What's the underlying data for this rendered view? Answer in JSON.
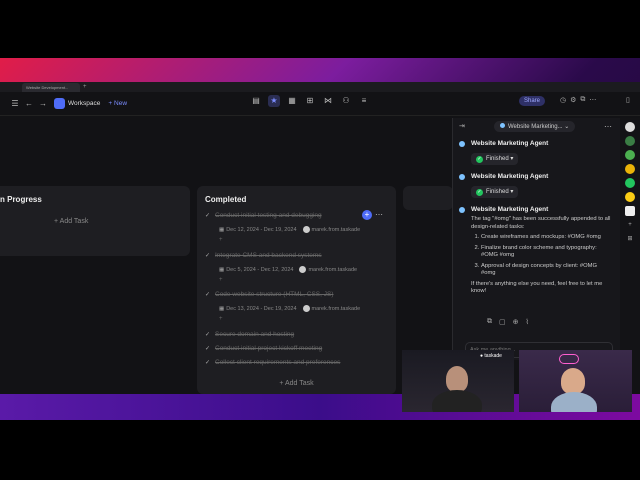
{
  "browser": {
    "tab_title": "Website Development...",
    "tab_new": "+"
  },
  "toolbar": {
    "workspace": "Workspace",
    "new": "+ New",
    "share": "Share",
    "icons": [
      "sidebar-toggle-icon",
      "back-icon",
      "forward-icon",
      "document-icon",
      "star-icon",
      "calendar-icon",
      "table-icon",
      "graph-icon",
      "org-chart-icon",
      "list-icon",
      "history-icon",
      "settings-icon",
      "copy-icon",
      "more-icon",
      "panel-icon"
    ]
  },
  "board": {
    "in_progress": {
      "title": "n Progress",
      "add_task": "+ Add Task"
    },
    "completed": {
      "title": "Completed",
      "add_task": "+ Add Task",
      "tasks": [
        {
          "label": "Conduct initial testing and debugging",
          "date": "Dec 12, 2024 - Dec 19, 2024",
          "assignee": "marek.from.taskade"
        },
        {
          "label": "Integrate CMS and backend systems",
          "date": "Dec 5, 2024 - Dec 12, 2024",
          "assignee": "marek.from.taskade"
        },
        {
          "label": "Code website structure (HTML, CSS, JS)",
          "date": "Dec 13, 2024 - Dec 19, 2024",
          "assignee": "marek.from.taskade"
        },
        {
          "label": "Secure domain and hosting"
        },
        {
          "label": "Conduct initial project kickoff meeting"
        },
        {
          "label": "Collect client requirements and preferences"
        }
      ]
    }
  },
  "agent_panel": {
    "agent_name": "Website Marketing...",
    "messages": [
      {
        "author": "Website Marketing Agent",
        "status": "Finished"
      },
      {
        "author": "Website Marketing Agent",
        "status": "Finished"
      },
      {
        "author": "Website Marketing Agent",
        "intro": "The tag \"#omg\" has been successfully appended to all design-related tasks:",
        "items": [
          "Create wireframes and mockups: #OMG #omg",
          "Finalize brand color scheme and typography: #OMG #omg",
          "Approval of design concepts by client: #OMG #omg"
        ],
        "outro": "If there's anything else you need, feel free to let me know!"
      }
    ],
    "input_placeholder": "Ask me anything..."
  },
  "webcam": {
    "label": "taskade"
  },
  "colors": {
    "accent": "#4f6cf7",
    "finished": "#22c55e",
    "agent_dot": "#7ec3ff"
  }
}
